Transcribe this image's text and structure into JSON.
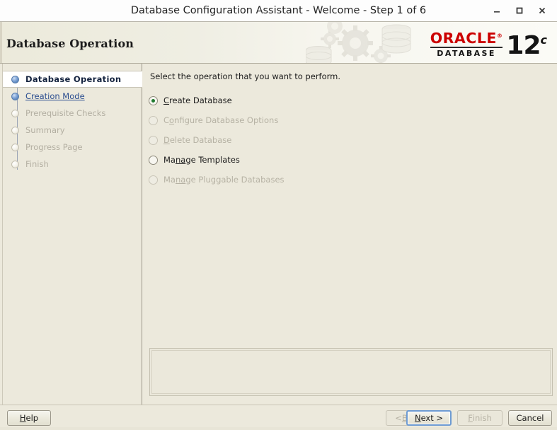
{
  "window": {
    "title": "Database Configuration Assistant - Welcome - Step 1 of 6",
    "controls": {
      "minimize": "minimize-icon",
      "maximize": "maximize-icon",
      "close": "close-icon"
    }
  },
  "header": {
    "title": "Database Operation",
    "art": "gears-and-database-graphic",
    "logo": {
      "brand": "ORACLE",
      "registered": "®",
      "product": "DATABASE",
      "version": "12",
      "version_suffix": "c"
    }
  },
  "sidebar": {
    "steps": [
      {
        "label": "Database Operation",
        "state": "current"
      },
      {
        "label": "Creation Mode",
        "state": "link"
      },
      {
        "label": "Prerequisite Checks",
        "state": "disabled"
      },
      {
        "label": "Summary",
        "state": "disabled"
      },
      {
        "label": "Progress Page",
        "state": "disabled"
      },
      {
        "label": "Finish",
        "state": "disabled"
      }
    ]
  },
  "main": {
    "instruction": "Select the operation that you want to perform.",
    "options": [
      {
        "label": "Create Database",
        "mnemonic": "C",
        "selected": true,
        "enabled": true
      },
      {
        "label": "Configure Database Options",
        "mnemonic": "o",
        "selected": false,
        "enabled": false
      },
      {
        "label": "Delete Database",
        "mnemonic": "D",
        "selected": false,
        "enabled": false
      },
      {
        "label": "Manage Templates",
        "mnemonic": "na",
        "selected": false,
        "enabled": true
      },
      {
        "label": "Manage Pluggable Databases",
        "mnemonic": "na",
        "selected": false,
        "enabled": false
      }
    ],
    "message_panel": ""
  },
  "footer": {
    "help": "Help",
    "back": "< Back",
    "next": "Next >",
    "finish": "Finish",
    "cancel": "Cancel"
  },
  "colors": {
    "window_bg": "#ece9dc",
    "oracle_red": "#cc0000",
    "selected_radio": "#1e7a2e",
    "link": "#2a4d8f",
    "focus_border": "#6e9bd2"
  }
}
